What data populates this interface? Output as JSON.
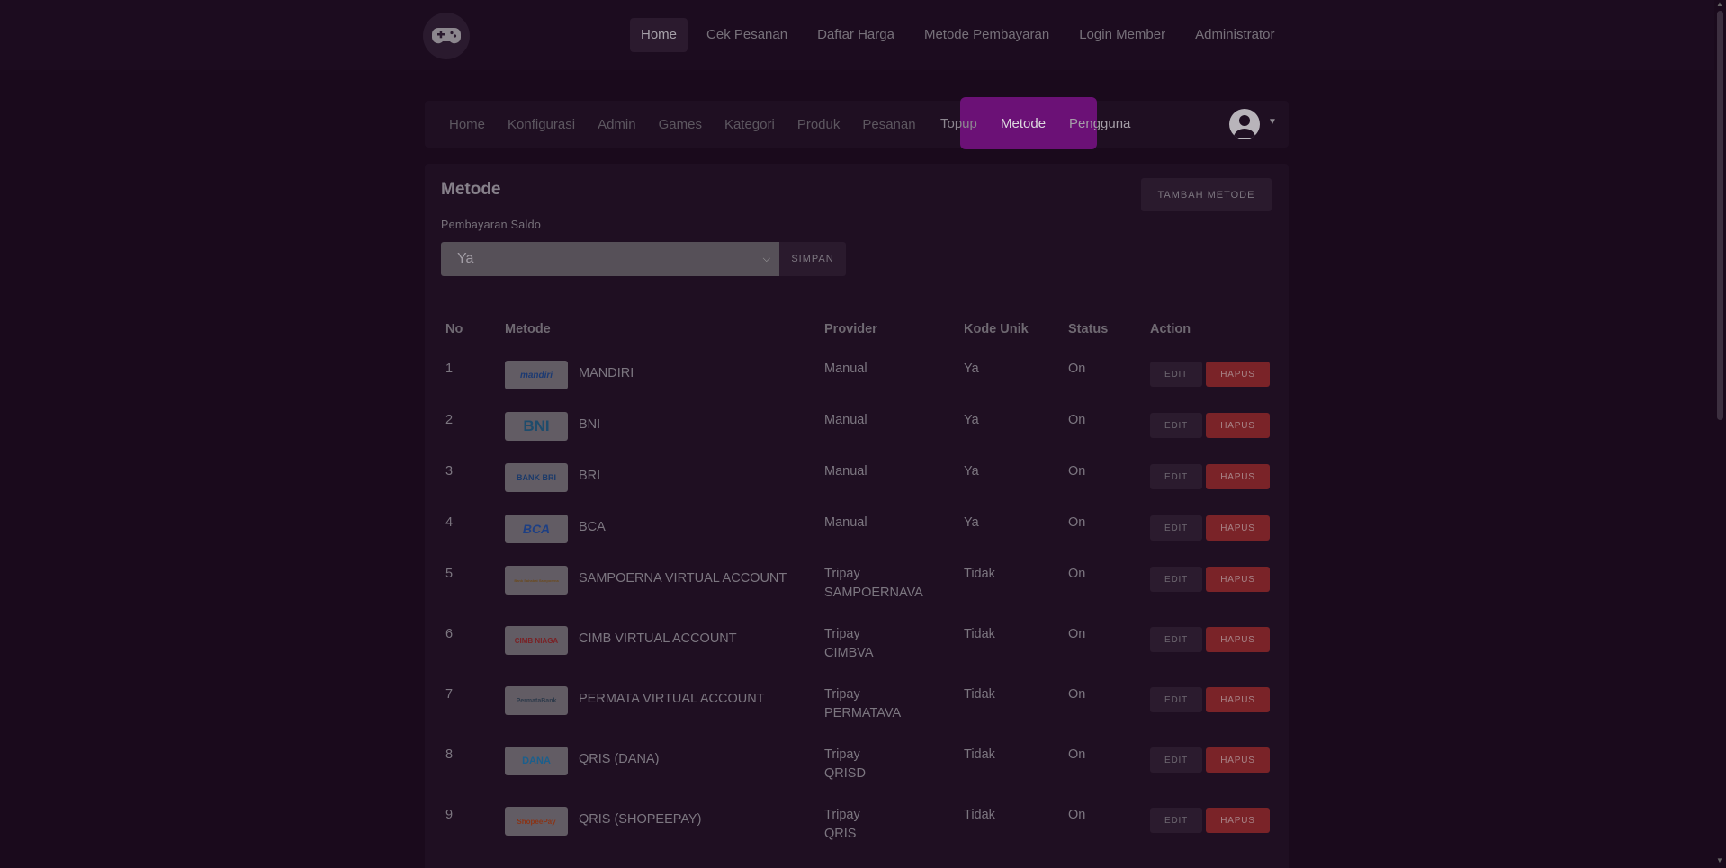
{
  "topnav": {
    "items": [
      "Home",
      "Cek Pesanan",
      "Daftar Harga",
      "Metode Pembayaran",
      "Login Member",
      "Administrator"
    ]
  },
  "subnav": {
    "items": [
      "Home",
      "Konfigurasi",
      "Admin",
      "Games",
      "Kategori",
      "Produk",
      "Pesanan",
      "Topup",
      "Metode",
      "Pengguna"
    ]
  },
  "page": {
    "title": "Metode",
    "add_button": "TAMBAH METODE",
    "saldo_label": "Pembayaran Saldo",
    "saldo_value": "Ya",
    "save_button": "SIMPAN"
  },
  "table": {
    "headers": [
      "No",
      "Metode",
      "Provider",
      "Kode Unik",
      "Status",
      "Action"
    ],
    "edit_label": "EDIT",
    "delete_label": "HAPUS",
    "rows": [
      {
        "no": "1",
        "logo": "mandiri",
        "name": "MANDIRI",
        "provider": "Manual",
        "provider2": "",
        "kode": "Ya",
        "status": "On"
      },
      {
        "no": "2",
        "logo": "BNI",
        "name": "BNI",
        "provider": "Manual",
        "provider2": "",
        "kode": "Ya",
        "status": "On"
      },
      {
        "no": "3",
        "logo": "BANK BRI",
        "name": "BRI",
        "provider": "Manual",
        "provider2": "",
        "kode": "Ya",
        "status": "On"
      },
      {
        "no": "4",
        "logo": "BCA",
        "name": "BCA",
        "provider": "Manual",
        "provider2": "",
        "kode": "Ya",
        "status": "On"
      },
      {
        "no": "5",
        "logo": "Bank Sahabat Sampoerna",
        "name": "SAMPOERNA VIRTUAL ACCOUNT",
        "provider": "Tripay",
        "provider2": "SAMPOERNAVA",
        "kode": "Tidak",
        "status": "On"
      },
      {
        "no": "6",
        "logo": "CIMB NIAGA",
        "name": "CIMB VIRTUAL ACCOUNT",
        "provider": "Tripay",
        "provider2": "CIMBVA",
        "kode": "Tidak",
        "status": "On"
      },
      {
        "no": "7",
        "logo": "PermataBank",
        "name": "PERMATA VIRTUAL ACCOUNT",
        "provider": "Tripay",
        "provider2": "PERMATAVA",
        "kode": "Tidak",
        "status": "On"
      },
      {
        "no": "8",
        "logo": "DANA",
        "name": "QRIS (DANA)",
        "provider": "Tripay",
        "provider2": "QRISD",
        "kode": "Tidak",
        "status": "On"
      },
      {
        "no": "9",
        "logo": "ShopeePay",
        "name": "QRIS (SHOPEEPAY)",
        "provider": "Tripay",
        "provider2": "QRIS",
        "kode": "Tidak",
        "status": "On"
      }
    ]
  },
  "colors": {
    "highlight": "#6b1176",
    "delete": "#7a2328",
    "background": "#1a0a1c"
  }
}
